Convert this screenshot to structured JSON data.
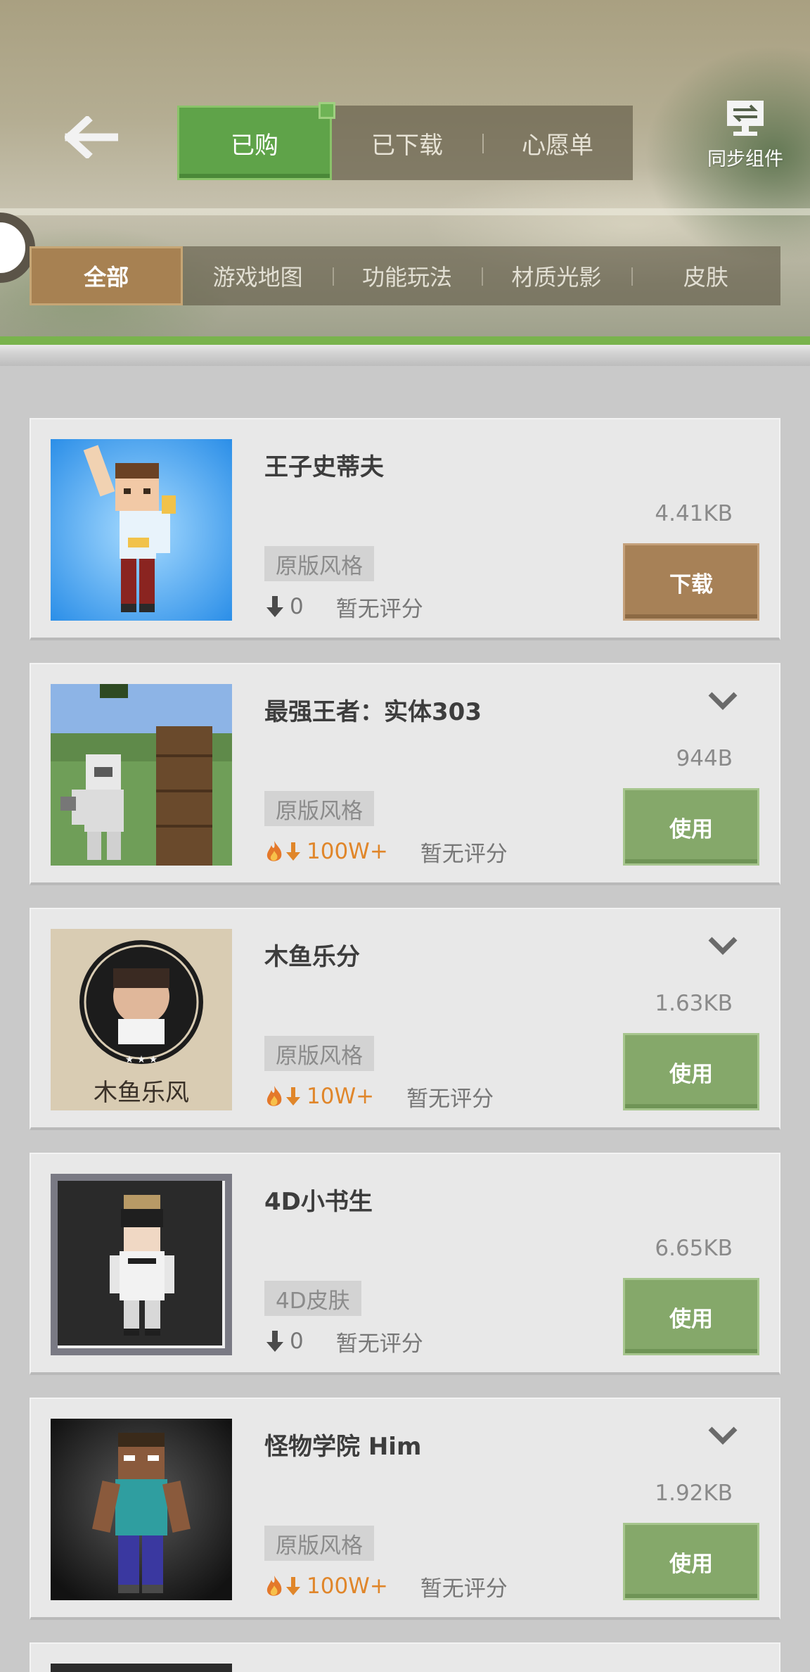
{
  "header": {
    "tabs": [
      {
        "label": "已购",
        "active": true
      },
      {
        "label": "已下载",
        "active": false
      },
      {
        "label": "心愿单",
        "active": false
      }
    ],
    "sync_label": "同步组件",
    "categories": [
      {
        "label": "全部",
        "active": true
      },
      {
        "label": "游戏地图",
        "active": false
      },
      {
        "label": "功能玩法",
        "active": false
      },
      {
        "label": "材质光影",
        "active": false
      },
      {
        "label": "皮肤",
        "active": false
      }
    ]
  },
  "items": [
    {
      "title": "王子史蒂夫",
      "size": "4.41KB",
      "tag": "原版风格",
      "downloads": "0",
      "hot": false,
      "rating": "暂无评分",
      "action": "下载",
      "action_type": "download",
      "chevron": false,
      "thumb_icon": "prince-steve-skin"
    },
    {
      "title": "最强王者：实体303",
      "size": "944B",
      "tag": "原版风格",
      "downloads": "100W+",
      "hot": true,
      "rating": "暂无评分",
      "action": "使用",
      "action_type": "use",
      "chevron": true,
      "thumb_icon": "entity-303-skin"
    },
    {
      "title": "木鱼乐分",
      "size": "1.63KB",
      "tag": "原版风格",
      "downloads": "10W+",
      "hot": true,
      "rating": "暂无评分",
      "action": "使用",
      "action_type": "use",
      "chevron": true,
      "thumb_icon": "muyu-logo",
      "thumb_text": "木鱼乐风"
    },
    {
      "title": "4D小书生",
      "size": "6.65KB",
      "tag": "4D皮肤",
      "downloads": "0",
      "hot": false,
      "rating": "暂无评分",
      "action": "使用",
      "action_type": "use",
      "chevron": false,
      "thumb_icon": "scholar-skin"
    },
    {
      "title": "怪物学院 Him",
      "size": "1.92KB",
      "tag": "原版风格",
      "downloads": "100W+",
      "hot": true,
      "rating": "暂无评分",
      "action": "使用",
      "action_type": "use",
      "chevron": true,
      "thumb_icon": "herobrine-skin"
    }
  ],
  "colors": {
    "tab_active": "#5fa349",
    "category_active": "#a78152",
    "download_button": "#a78157",
    "use_button": "#85a86a",
    "hot_count": "#e0862a",
    "accent_bar": "#79b34d"
  }
}
